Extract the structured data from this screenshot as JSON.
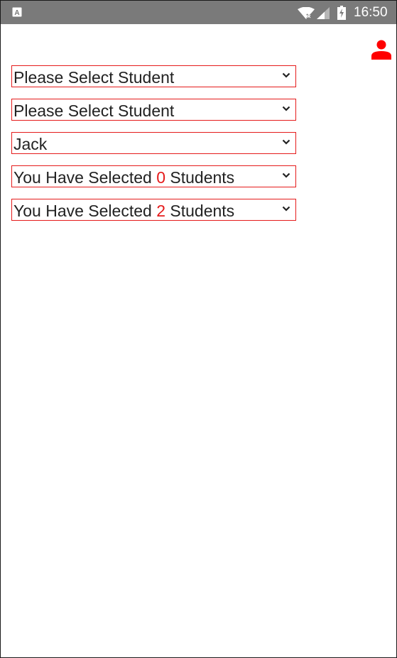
{
  "status_bar": {
    "time": "16:50",
    "icons": [
      "app-notification-icon",
      "wifi-icon",
      "signal-icon",
      "battery-charging-icon"
    ]
  },
  "header": {
    "profile_icon": "person-icon",
    "profile_icon_color": "#ff0000"
  },
  "dropdowns": [
    {
      "text": "Please Select Student"
    },
    {
      "text": "Please Select Student"
    },
    {
      "text": "Jack"
    },
    {
      "prefix": "You Have Selected ",
      "count": "0",
      "suffix": " Students"
    },
    {
      "prefix": "You Have Selected ",
      "count": "2",
      "suffix": " Students"
    }
  ],
  "colors": {
    "accent": "#e51b1b",
    "status_bar": "#7a7a7a"
  }
}
